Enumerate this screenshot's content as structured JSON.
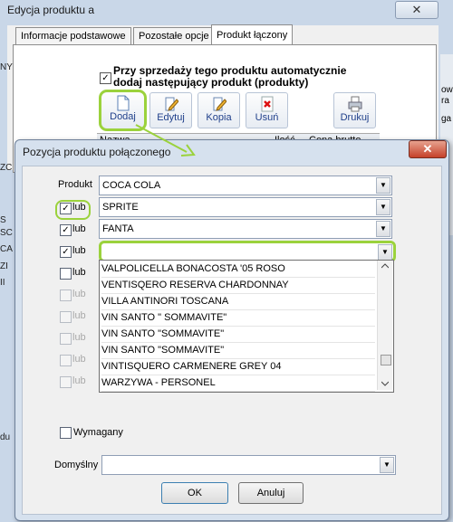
{
  "background_window": {
    "title": "Edycja produktu a",
    "close_label": "✕",
    "tabs": [
      "Informacje podstawowe",
      "Pozostałe opcje",
      "Produkt łączony"
    ],
    "auto_checkbox_label": "Przy sprzedaży tego produktu automatycznie dodaj  następujący produkt (produkty)",
    "auto_checked": "✓",
    "toolbar": [
      "Dodaj",
      "Edytuj",
      "Kopia",
      "Usuń",
      "Drukuj"
    ],
    "grid_columns": [
      "Nazwa",
      "Ilość",
      "Cena brutto"
    ],
    "left_fragments": [
      "NY",
      "S",
      "SC",
      "CA",
      "ZI",
      "II",
      "ZC",
      "du"
    ],
    "right_fragments": [
      "owi",
      "ra",
      "ga"
    ]
  },
  "dialog": {
    "title": "Pozycja produktu połączonego",
    "close_label": "✕",
    "product_label": "Produkt",
    "product_value": "COCA COLA",
    "lub_label": "lub",
    "alt_rows": [
      {
        "value": "SPRITE",
        "checked": true
      },
      {
        "value": "FANTA",
        "checked": true
      },
      {
        "value": "",
        "checked": true
      },
      {
        "value": "",
        "checked": false
      },
      {
        "value": "",
        "checked": false,
        "disabled": true
      },
      {
        "value": "",
        "checked": false,
        "disabled": true
      },
      {
        "value": "",
        "checked": false,
        "disabled": true
      },
      {
        "value": "",
        "checked": false,
        "disabled": true
      },
      {
        "value": "",
        "checked": false,
        "disabled": true
      }
    ],
    "dropdown_items": [
      "VALPOLICELLA BONACOSTA '05 ROSO",
      "VENTISQERO RESERVA CHARDONNAY",
      "VILLA ANTINORI TOSCANA",
      "VIN SANTO \" SOMMAVITE\"",
      "VIN SANTO \"SOMMAVITE\"",
      "VIN SANTO \"SOMMAVITE\"",
      "VINTISQUERO CARMENERE GREY 04",
      "WARZYWA - PERSONEL"
    ],
    "wymagany_label": "Wymagany",
    "domyslny_label": "Domyślny",
    "domyslny_value": "",
    "ok_label": "OK",
    "cancel_label": "Anuluj",
    "check_mark": "✓",
    "combo_arrow": "▼"
  }
}
